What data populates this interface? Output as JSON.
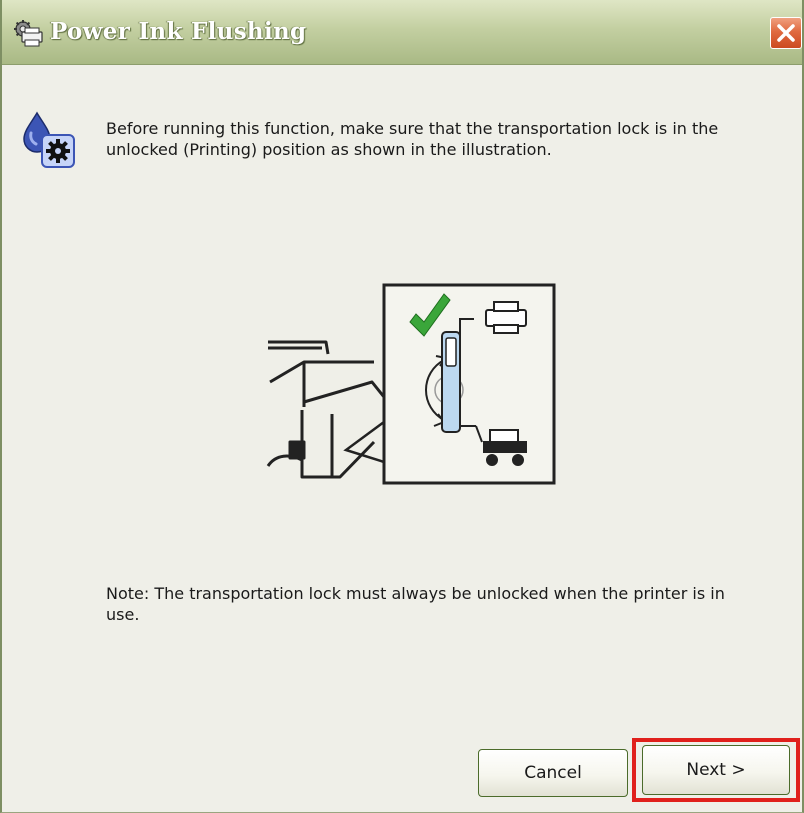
{
  "window": {
    "title": "Power Ink Flushing",
    "title_icon": "printer-gear-icon",
    "close_icon": "close-icon"
  },
  "main": {
    "info_icon": "ink-drop-gear-icon",
    "message": "Before running this function, make sure that the transportation lock is in the unlocked (Printing) position as shown in the illustration.",
    "illustration": {
      "icons": [
        "printer-body-icon",
        "checkmark-icon",
        "printer-icon",
        "lock-switch-icon",
        "rotate-arrows-icon",
        "cart-icon"
      ]
    },
    "note": "Note: The transportation lock must always be unlocked when the printer is in use."
  },
  "buttons": {
    "cancel_label": "Cancel",
    "next_label": "Next >"
  },
  "colors": {
    "titlebar": "#c3cfa1",
    "dialog_background": "#efefe8",
    "close_button": "#e06a40",
    "highlight": "#e0201c",
    "checkmark": "#3aa63a",
    "lock_switch": "#bcd8f0"
  }
}
